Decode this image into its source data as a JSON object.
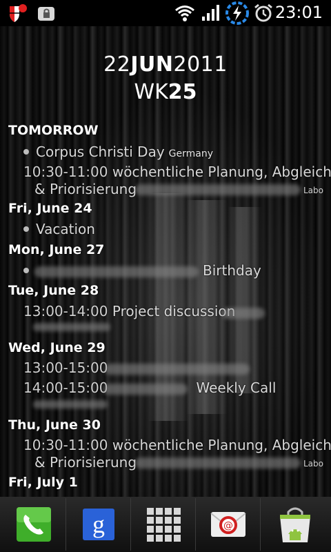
{
  "status_bar": {
    "time": "23:01",
    "icons": [
      "shield-alert-icon",
      "lock-app-icon",
      "wifi-icon",
      "signal-icon",
      "sync-icon",
      "alarm-icon"
    ]
  },
  "widget": {
    "date_day": "22",
    "date_month": "JUN",
    "date_year": "2011",
    "week_prefix": "WK",
    "week_number": "25"
  },
  "agenda": {
    "days": {
      "tomorrow": "TOMORROW",
      "jun24": "Fri, June 24",
      "jun27": "Mon, June 27",
      "jun28": "Tue, June 28",
      "jun29": "Wed, June 29",
      "jun30": "Thu, June 30",
      "jul1": "Fri, July 1"
    },
    "events": {
      "corpus_title": "Corpus Christi Day",
      "corpus_location": "Germany",
      "planning1_time": "10:30-11:00",
      "planning1_title": "wöchentliche Planung, Abgleich",
      "planning1_title2": "& Priorisierung",
      "planning1_cut": "Labo",
      "vacation_title": "Vacation",
      "birthday_title": "Birthday",
      "project_time": "13:00-14:00",
      "project_title": "Project discussion",
      "wed_event1_time": "13:00-15:00",
      "wed_event2_time": "14:00-15:00",
      "wed_event2_title": "Weekly Call",
      "planning2_time": "10:30-11:00",
      "planning2_title": "wöchentliche Planung, Abgleich",
      "planning2_title2": "& Priorisierung",
      "planning2_cut": "Labo"
    }
  },
  "dock": {
    "items": [
      "phone-icon",
      "google-search-icon",
      "app-drawer-icon",
      "email-icon",
      "market-icon"
    ],
    "colors": {
      "phone": "#3fae2a",
      "google": "#2a62d8",
      "email_ring": "#d02020",
      "market_bag": "#e8e8e8",
      "android": "#8fc440"
    }
  }
}
